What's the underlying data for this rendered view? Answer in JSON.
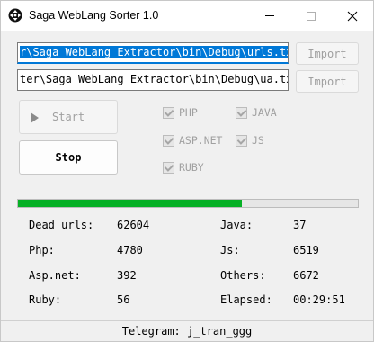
{
  "window": {
    "title": "Saga WebLang Sorter 1.0"
  },
  "inputs": {
    "urls_path": "r\\Saga WebLang Extractor\\bin\\Debug\\urls.txt",
    "ua_path": "ter\\Saga WebLang Extractor\\bin\\Debug\\ua.txt"
  },
  "buttons": {
    "import1": "Import",
    "import2": "Import",
    "start": "Start",
    "stop": "Stop"
  },
  "checkboxes": {
    "php": "PHP",
    "java": "JAVA",
    "aspnet": "ASP.NET",
    "js": "JS",
    "ruby": "RUBY"
  },
  "progress": {
    "fraction": 0.66,
    "color": "#06b025"
  },
  "stats": {
    "dead_label": "Dead urls:",
    "dead_value": "62604",
    "php_label": "Php:",
    "php_value": "4780",
    "asp_label": "Asp.net:",
    "asp_value": "392",
    "ruby_label": "Ruby:",
    "ruby_value": "56",
    "java_label": "Java:",
    "java_value": "37",
    "js_label": "Js:",
    "js_value": "6519",
    "others_label": "Others:",
    "others_value": "6672",
    "elapsed_label": "Elapsed:",
    "elapsed_value": "00:29:51"
  },
  "footer": {
    "text": "Telegram: j_tran_ggg"
  },
  "colors": {
    "accent": "#0078d7",
    "progress": "#06b025"
  },
  "icons": {
    "app": "move-arrows-icon",
    "minimize": "minimize-icon",
    "maximize": "maximize-icon",
    "close": "close-icon",
    "start": "play-icon"
  }
}
